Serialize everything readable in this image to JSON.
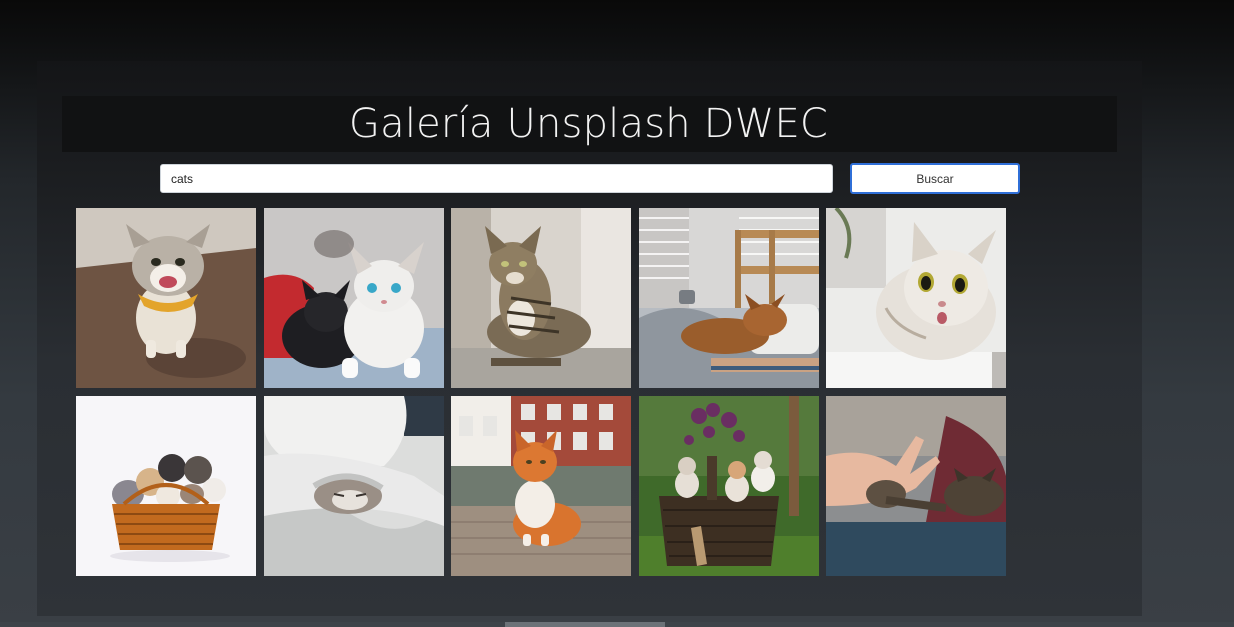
{
  "header": {
    "title": "Galería Unsplash DWEC"
  },
  "search": {
    "value": "cats",
    "button_label": "Buscar"
  },
  "gallery": {
    "images": [
      {
        "name": "cat-laughing-bandana-image"
      },
      {
        "name": "kittens-black-white-image"
      },
      {
        "name": "tabby-cat-couch-image"
      },
      {
        "name": "cat-sleeping-bed-image"
      },
      {
        "name": "surprised-cat-image"
      },
      {
        "name": "kittens-basket-image"
      },
      {
        "name": "cat-under-blanket-image"
      },
      {
        "name": "orange-cat-street-image"
      },
      {
        "name": "kittens-basket-garden-image"
      },
      {
        "name": "hand-cat-paw-image"
      }
    ]
  },
  "colors": {
    "accent": "#2f6fd8",
    "background": "#343a40"
  }
}
